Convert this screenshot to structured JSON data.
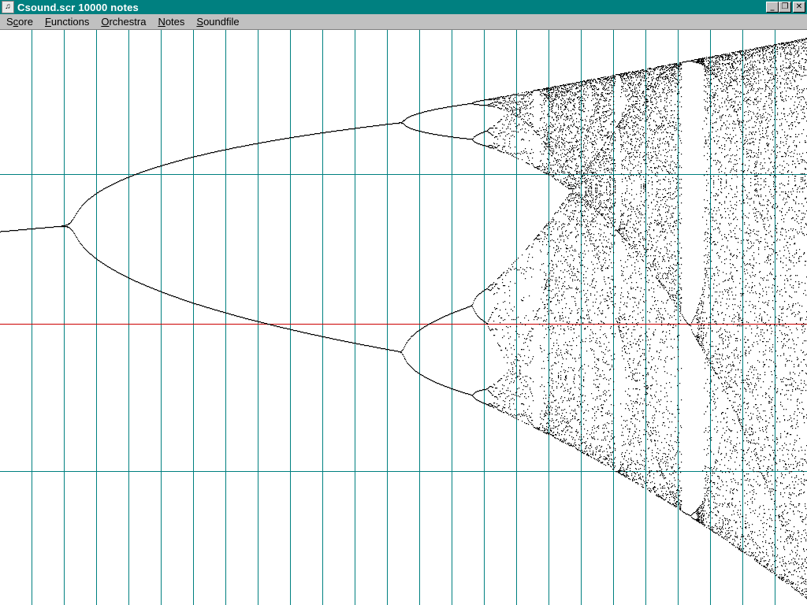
{
  "window": {
    "title": "Csound.scr 10000 notes",
    "icon": "csound-app-icon",
    "controls": [
      {
        "name": "minimize-button",
        "glyph": "_"
      },
      {
        "name": "restore-button",
        "glyph": "❐"
      },
      {
        "name": "close-button",
        "glyph": "✕"
      }
    ]
  },
  "menu": {
    "items": [
      {
        "label_pre": "S",
        "mnemonic": "c",
        "label_post": "ore"
      },
      {
        "label_pre": "",
        "mnemonic": "F",
        "label_post": "unctions"
      },
      {
        "label_pre": "",
        "mnemonic": "O",
        "label_post": "rchestra"
      },
      {
        "label_pre": "",
        "mnemonic": "N",
        "label_post": "otes"
      },
      {
        "label_pre": "",
        "mnemonic": "S",
        "label_post": "oundfile"
      }
    ]
  },
  "colors": {
    "title_bg": "#008080",
    "grid": "#008080",
    "center_line": "#cc0000",
    "points": "#000000",
    "menu_bg": "#c0c0c0"
  },
  "plot": {
    "description_free": true,
    "vertical_grid_lines": 25,
    "horizontal_grid_lines": 3
  }
}
